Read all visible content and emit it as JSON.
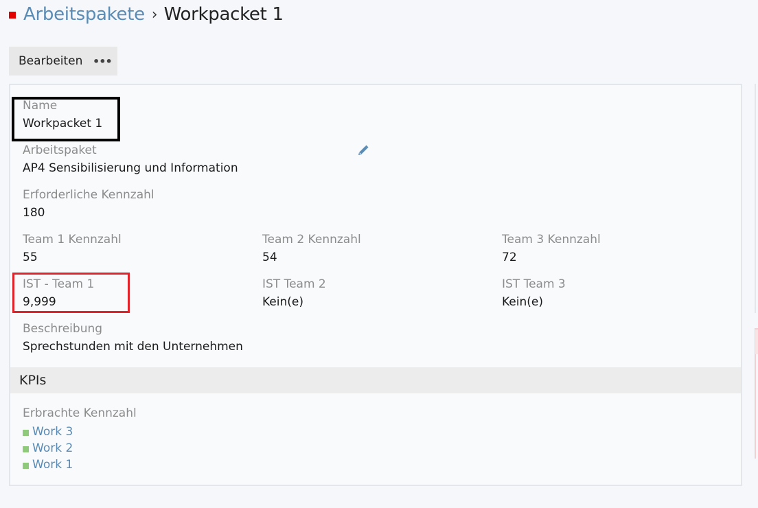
{
  "breadcrumb": {
    "parent": "Arbeitspakete",
    "separator": "›",
    "current": "Workpacket 1"
  },
  "toolbar": {
    "edit_label": "Bearbeiten",
    "more_label": "•••"
  },
  "fields": {
    "name": {
      "label": "Name",
      "value": "Workpacket 1"
    },
    "arbeitspaket": {
      "label": "Arbeitspaket",
      "value": "AP4 Sensibilisierung und Information"
    },
    "erforderliche": {
      "label": "Erforderliche Kennzahl",
      "value": "180"
    },
    "team1": {
      "label": "Team 1 Kennzahl",
      "value": "55"
    },
    "team2": {
      "label": "Team 2 Kennzahl",
      "value": "54"
    },
    "team3": {
      "label": "Team 3 Kennzahl",
      "value": "72"
    },
    "ist1": {
      "label": "IST - Team 1",
      "value": "9,999"
    },
    "ist2": {
      "label": "IST Team 2",
      "value": "Kein(e)"
    },
    "ist3": {
      "label": "IST Team 3",
      "value": "Kein(e)"
    },
    "beschreibung": {
      "label": "Beschreibung",
      "value": "Sprechstunden mit den Unternehmen"
    }
  },
  "kpis": {
    "title": "KPIs",
    "label": "Erbrachte Kennzahl",
    "items": [
      "Work 3",
      "Work 2",
      "Work 1"
    ]
  },
  "colors": {
    "accent_red": "#e00000",
    "link_blue": "#5a8bb5",
    "status_green": "#8fc97a",
    "highlight_black": "#000000",
    "highlight_red": "#e0242c"
  },
  "icons": {
    "status": "red-square-icon",
    "edit": "pencil-icon",
    "more": "ellipsis-icon",
    "work_status": "green-square-icon"
  }
}
